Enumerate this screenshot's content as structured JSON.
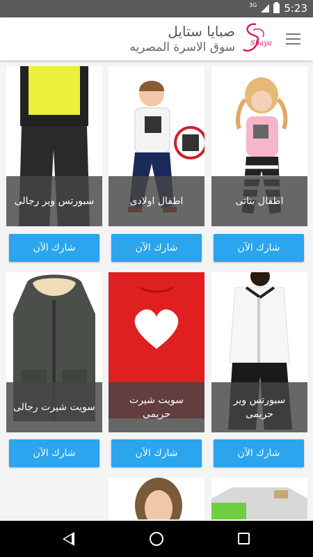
{
  "status_bar": {
    "network": "3G",
    "time": "5:23"
  },
  "header": {
    "title": "صبايا ستايل",
    "subtitle": "سوق الاسرة المصريه",
    "logo_text": "Sbaya"
  },
  "products": [
    {
      "label": "اطفال بناتى",
      "button": "شارك الآن"
    },
    {
      "label": "اطفال اولادى",
      "button": "شارك الآن"
    },
    {
      "label": "سبورتس وير رجالى",
      "button": "شارك الآن"
    },
    {
      "label": "سبورتس وير حريمى",
      "button": "شارك الآن"
    },
    {
      "label": "سويت شيرت حريمى",
      "button": "شارك الآن"
    },
    {
      "label": "سويت شيرت رجالى",
      "button": "شارك الآن"
    }
  ],
  "colors": {
    "accent": "#2aa5ee",
    "brand": "#d81b60",
    "overlay": "#464646"
  }
}
